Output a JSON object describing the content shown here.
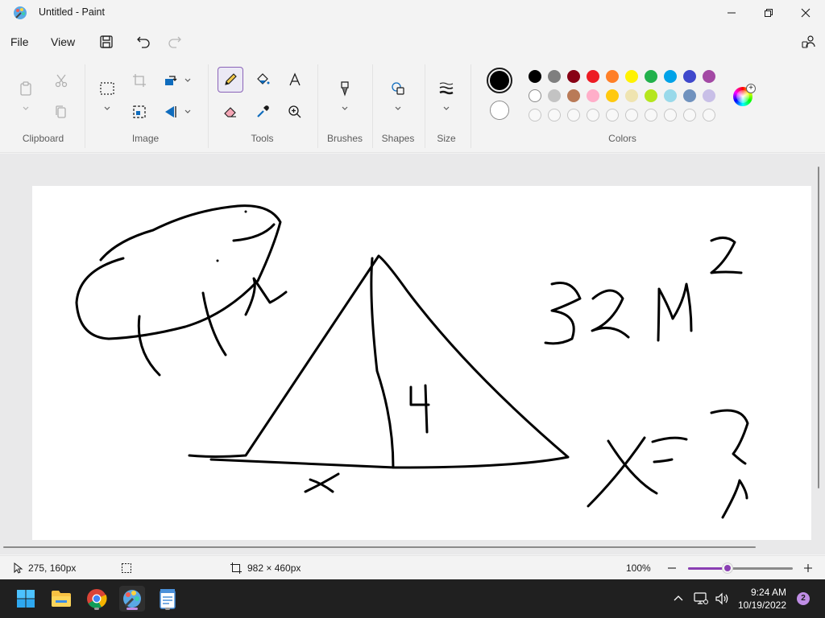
{
  "window": {
    "title": "Untitled - Paint"
  },
  "menu": {
    "file": "File",
    "view": "View"
  },
  "ribbon": {
    "groups": {
      "clipboard": "Clipboard",
      "image": "Image",
      "tools": "Tools",
      "brushes": "Brushes",
      "shapes": "Shapes",
      "size": "Size",
      "colors": "Colors"
    },
    "selected_tool": "pencil",
    "primary_color": "#000000",
    "secondary_color": "#ffffff",
    "palette": [
      [
        "#000000",
        "#7f7f7f",
        "#880015",
        "#ed1c24",
        "#ff7f27",
        "#fff200",
        "#22b14c",
        "#00a2e8",
        "#3f48cc",
        "#a349a4"
      ],
      [
        "#ffffff",
        "#c3c3c3",
        "#b97a57",
        "#ffaec9",
        "#ffc90e",
        "#efe4b0",
        "#b5e61d",
        "#99d9ea",
        "#7092be",
        "#c8bfe7"
      ],
      [
        "",
        "",
        "",
        "",
        "",
        "",
        "",
        "",
        "",
        ""
      ]
    ]
  },
  "canvas": {
    "drawing": "hand-drawn sketch: turtle-like creature, triangle with height 4, base x, 32 m^2, x = ?",
    "strokes": [
      "turtle-shell-outline",
      "turtle-legs",
      "triangle",
      "triangle-height-line",
      "digit-4",
      "letter-x-base",
      "text-32m",
      "superscript-2",
      "equation-x-equals",
      "question-mark"
    ]
  },
  "status": {
    "cursor_position": "275, 160px",
    "canvas_size": "982 × 460px",
    "zoom": "100%",
    "zoom_fraction": 0.38
  },
  "taskbar": {
    "time": "9:24 AM",
    "date": "10/19/2022",
    "notifications": "2"
  }
}
